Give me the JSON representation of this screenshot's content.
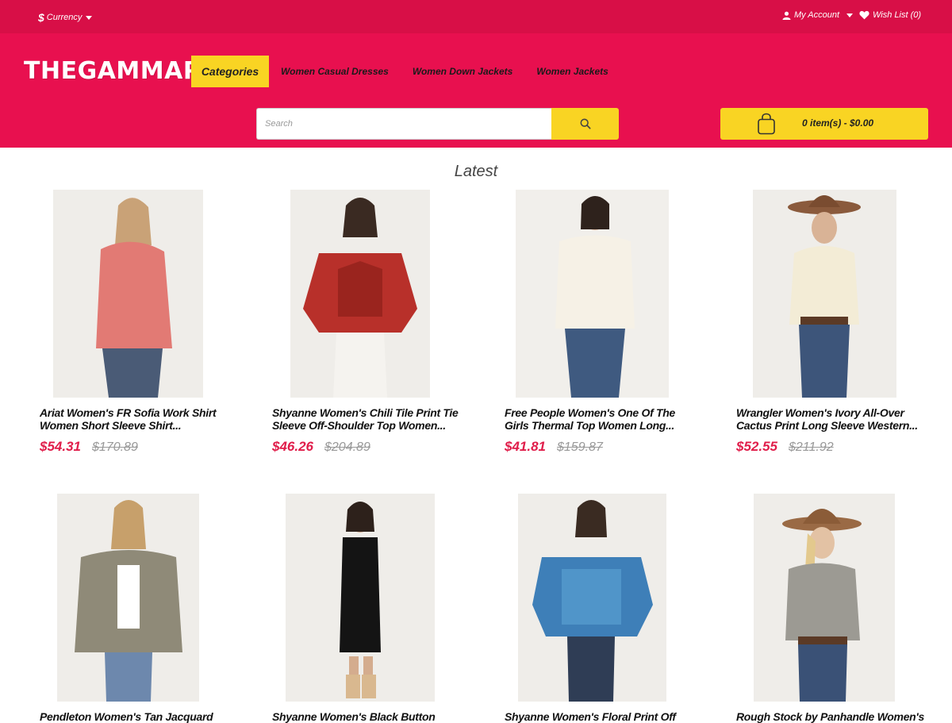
{
  "topbar": {
    "currency_symbol": "$",
    "currency_label": "Currency",
    "account_label": "My Account",
    "wishlist_label": "Wish List (0)"
  },
  "header": {
    "logo": "THEGAMMAPH",
    "categories_label": "Categories",
    "nav_links": [
      "Women Casual Dresses",
      "Women Down Jackets",
      "Women Jackets"
    ],
    "search_placeholder": "Search",
    "cart_label": "0 item(s) - $0.00"
  },
  "colors": {
    "topbar": "#d80f47",
    "header": "#e8104f",
    "accent": "#f9d423",
    "price": "#e01d4a"
  },
  "main": {
    "section_title": "Latest",
    "products": [
      {
        "name_line1": "Ariat Women's FR Sofia Work Shirt",
        "name_line2": "Women Short Sleeve Shirt...",
        "price": "$54.31",
        "old_price": "$170.89"
      },
      {
        "name_line1": "Shyanne Women's Chili Tile Print Tie",
        "name_line2": "Sleeve Off-Shoulder Top Women...",
        "price": "$46.26",
        "old_price": "$204.89"
      },
      {
        "name_line1": "Free People Women's One Of The",
        "name_line2": "Girls Thermal Top Women Long...",
        "price": "$41.81",
        "old_price": "$159.87"
      },
      {
        "name_line1": "Wrangler Women's Ivory All-Over",
        "name_line2": "Cactus Print Long Sleeve Western...",
        "price": "$52.55",
        "old_price": "$211.92"
      },
      {
        "name_line1": "Pendleton Women's Tan Jacquard",
        "name_line2": "",
        "price": "",
        "old_price": ""
      },
      {
        "name_line1": "Shyanne Women's Black Button",
        "name_line2": "",
        "price": "",
        "old_price": ""
      },
      {
        "name_line1": "Shyanne Women's Floral Print Off",
        "name_line2": "",
        "price": "",
        "old_price": ""
      },
      {
        "name_line1": "Rough Stock by Panhandle Women's",
        "name_line2": "",
        "price": "",
        "old_price": ""
      }
    ]
  }
}
